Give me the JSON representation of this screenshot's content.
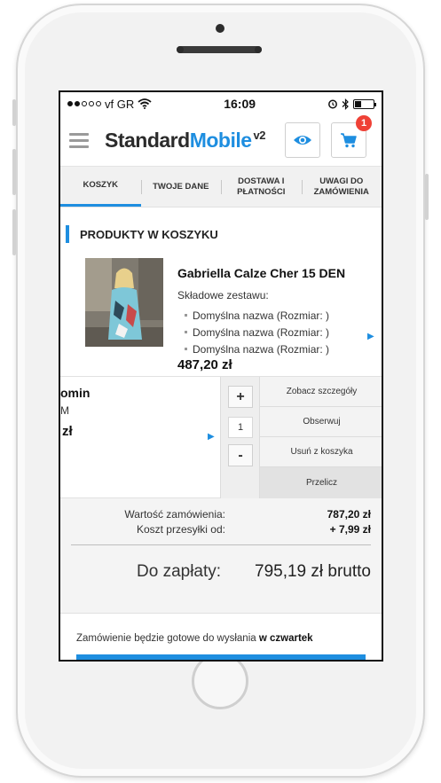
{
  "status_bar": {
    "carrier": "vf GR",
    "time": "16:09"
  },
  "header": {
    "logo_main": "Standard",
    "logo_accent": "Mobile",
    "logo_version": "v2",
    "cart_count": "1"
  },
  "tabs": [
    {
      "label": "KOSZYK"
    },
    {
      "label": "TWOJE DANE"
    },
    {
      "label": "DOSTAWA I PŁATNOŚCI"
    },
    {
      "label": "UWAGI DO ZAMÓWIENIA"
    }
  ],
  "section_title": "PRODUKTY W KOSZYKU",
  "product": {
    "name": "Gabriella Calze Cher 15 DEN",
    "components_label": "Składowe zestawu:",
    "components": [
      "Domyślna nazwa (Rozmiar: )",
      "Domyślna nazwa (Rozmiar: )",
      "Domyślna nazwa (Rozmiar: )"
    ],
    "price": "487,20 zł"
  },
  "swipe_row": {
    "name_fragment": "omin",
    "sub_fragment": "M",
    "price_fragment": "zł",
    "quantity": "1",
    "plus_label": "+",
    "minus_label": "-",
    "actions": {
      "details": "Zobacz szczegóły",
      "watch": "Obserwuj",
      "remove": "Usuń z koszyka",
      "recalculate": "Przelicz"
    }
  },
  "summary": {
    "order_value_label": "Wartość zamówienia:",
    "order_value": "787,20 zł",
    "shipping_label": "Koszt przesyłki od:",
    "shipping_value": "+ 7,99 zł",
    "total_label": "Do zapłaty:",
    "total_value": "795,19 zł brutto"
  },
  "ready_notice": {
    "text": "Zamówienie będzie gotowe do wysłania",
    "day": "w czwartek"
  },
  "colors": {
    "accent": "#1e8ee0",
    "badge": "#ef4136"
  }
}
